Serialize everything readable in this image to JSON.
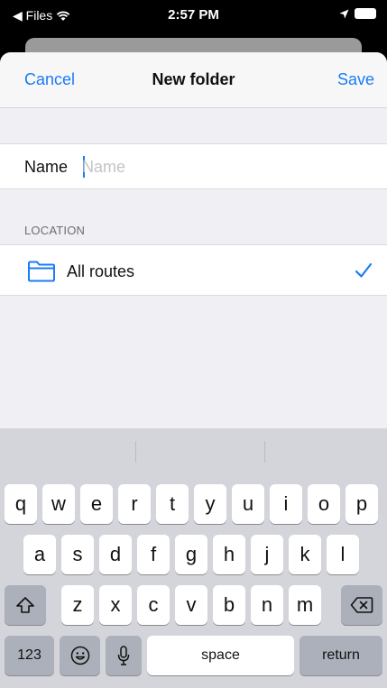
{
  "status_bar": {
    "back_label": "◀ Files",
    "time": "2:57 PM"
  },
  "nav": {
    "cancel": "Cancel",
    "title": "New folder",
    "save": "Save"
  },
  "name_field": {
    "label": "Name",
    "placeholder": "Name",
    "value": ""
  },
  "location": {
    "header": "LOCATION",
    "selected": "All routes"
  },
  "keyboard": {
    "row1": [
      "q",
      "w",
      "e",
      "r",
      "t",
      "y",
      "u",
      "i",
      "o",
      "p"
    ],
    "row2": [
      "a",
      "s",
      "d",
      "f",
      "g",
      "h",
      "j",
      "k",
      "l"
    ],
    "row3": [
      "z",
      "x",
      "c",
      "v",
      "b",
      "n",
      "m"
    ],
    "numbers_key": "123",
    "space_key": "space",
    "return_key": "return"
  },
  "colors": {
    "accent": "#1b7cf5",
    "keyboard_bg": "#d3d5da",
    "group_bg": "#efeff4"
  },
  "icons": [
    "wifi-icon",
    "location-arrow-icon",
    "battery-icon",
    "folder-icon",
    "checkmark-icon",
    "shift-icon",
    "delete-icon",
    "emoji-icon",
    "microphone-icon"
  ]
}
